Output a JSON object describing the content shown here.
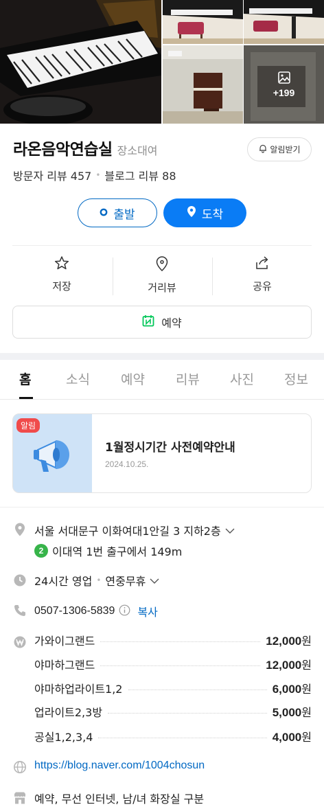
{
  "gallery": {
    "more_count": "+199"
  },
  "place": {
    "name": "라온음악연습실",
    "category": "장소대여",
    "notify_label": "알림받기"
  },
  "reviews": {
    "visitor": "방문자 리뷰 457",
    "blog": "블로그 리뷰 88"
  },
  "route": {
    "start_label": "출발",
    "arrive_label": "도착"
  },
  "actions": {
    "save": "저장",
    "street_view": "거리뷰",
    "share": "공유"
  },
  "reserve_label": "예약",
  "tabs": [
    "홈",
    "소식",
    "예약",
    "리뷰",
    "사진",
    "정보"
  ],
  "notice": {
    "badge": "알림",
    "title": "1월정시기간 사전예약안내",
    "date": "2024.10.25."
  },
  "info": {
    "address": "서울 서대문구 이화여대1안길 3 지하2층",
    "subway_line": "2",
    "subway_text": "이대역 1번 출구에서 149m",
    "hours": "24시간 영업",
    "hours_note": "연중무휴",
    "phone": "0507-1306-5839",
    "copy_label": "복사",
    "prices": [
      {
        "name": "가와이그랜드",
        "amount": "12,000",
        "unit": "원"
      },
      {
        "name": "야마하그랜드",
        "amount": "12,000",
        "unit": "원"
      },
      {
        "name": "야마하업라이트1,2",
        "amount": "6,000",
        "unit": "원"
      },
      {
        "name": "업라이트2,3방",
        "amount": "5,000",
        "unit": "원"
      },
      {
        "name": "공실1,2,3,4",
        "amount": "4,000",
        "unit": "원"
      }
    ],
    "homepage": "https://blog.naver.com/1004chosun",
    "amenities": "예약, 무선 인터넷, 남/녀 화장실 구분"
  },
  "colors": {
    "primary": "#0a7cf5",
    "link": "#0068c3",
    "subway_line_2": "#37b44a",
    "badge_red": "#f04b4b"
  }
}
